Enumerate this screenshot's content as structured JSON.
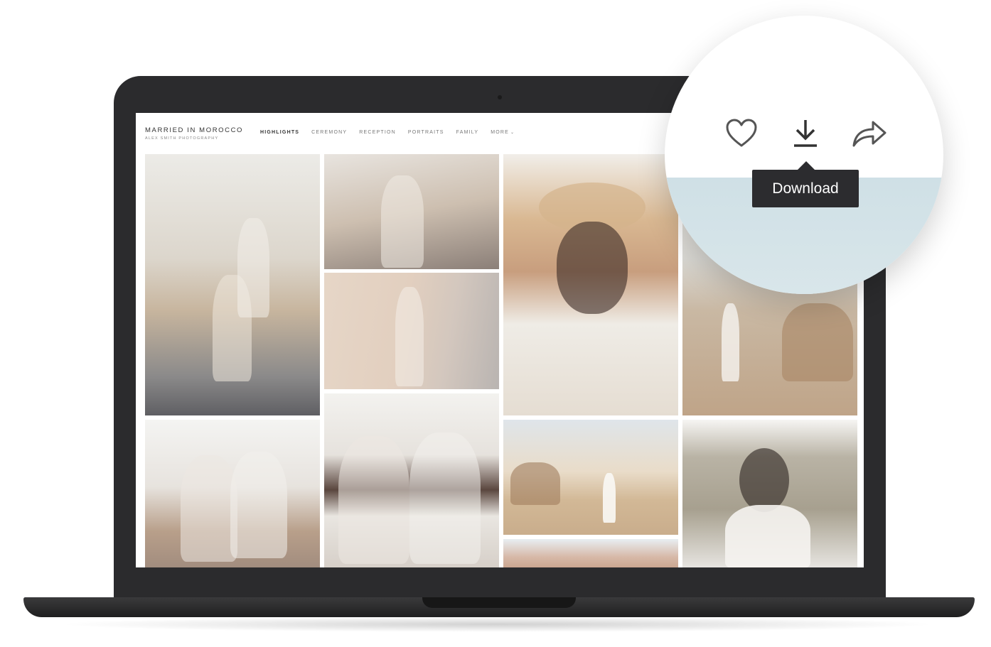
{
  "site": {
    "title": "MARRIED IN MOROCCO",
    "subtitle": "ALEX SMITH PHOTOGRAPHY"
  },
  "nav": {
    "items": [
      {
        "label": "HIGHLIGHTS",
        "active": true
      },
      {
        "label": "CEREMONY",
        "active": false
      },
      {
        "label": "RECEPTION",
        "active": false
      },
      {
        "label": "PORTRAITS",
        "active": false
      },
      {
        "label": "FAMILY",
        "active": false
      },
      {
        "label": "MORE",
        "active": false
      }
    ]
  },
  "zoom": {
    "icons": [
      "heart-icon",
      "download-icon",
      "share-icon"
    ],
    "tooltip": "Download"
  },
  "colors": {
    "laptop": "#2b2b2d",
    "tooltip_bg": "#2c2c2f",
    "icon": "#555555"
  }
}
